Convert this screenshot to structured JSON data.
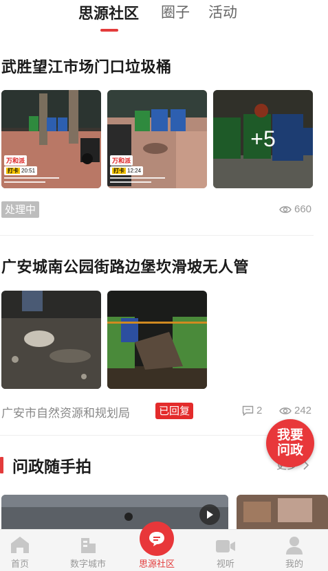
{
  "top_tabs": [
    {
      "label": "思源社区",
      "active": true
    },
    {
      "label": "圈子",
      "active": false
    },
    {
      "label": "活动",
      "active": false
    }
  ],
  "posts": [
    {
      "title": "武胜望江市场门口垃圾桶",
      "image_count_more": "+5",
      "watermark_logo": "万和派",
      "watermark_times": [
        "20:51",
        "12:24"
      ],
      "watermark_tag": "打卡",
      "status": "处理中",
      "views": "660"
    },
    {
      "title": "广安城南公园街路边堡坎滑坡无人管",
      "department": "广安市自然资源和规划局",
      "status": "已回复",
      "comments": "2",
      "views": "242"
    }
  ],
  "section": {
    "title": "问政随手拍",
    "more": "更多"
  },
  "fab_label": "我要问政",
  "bottom_nav": [
    {
      "label": "首页",
      "icon": "home-icon"
    },
    {
      "label": "数字城市",
      "icon": "city-icon"
    },
    {
      "label": "思源社区",
      "icon": "community-icon",
      "active": true
    },
    {
      "label": "视听",
      "icon": "video-icon"
    },
    {
      "label": "我的",
      "icon": "profile-icon"
    }
  ],
  "colors": {
    "accent": "#e33b3b",
    "badge_gray": "#bdbdbd"
  }
}
